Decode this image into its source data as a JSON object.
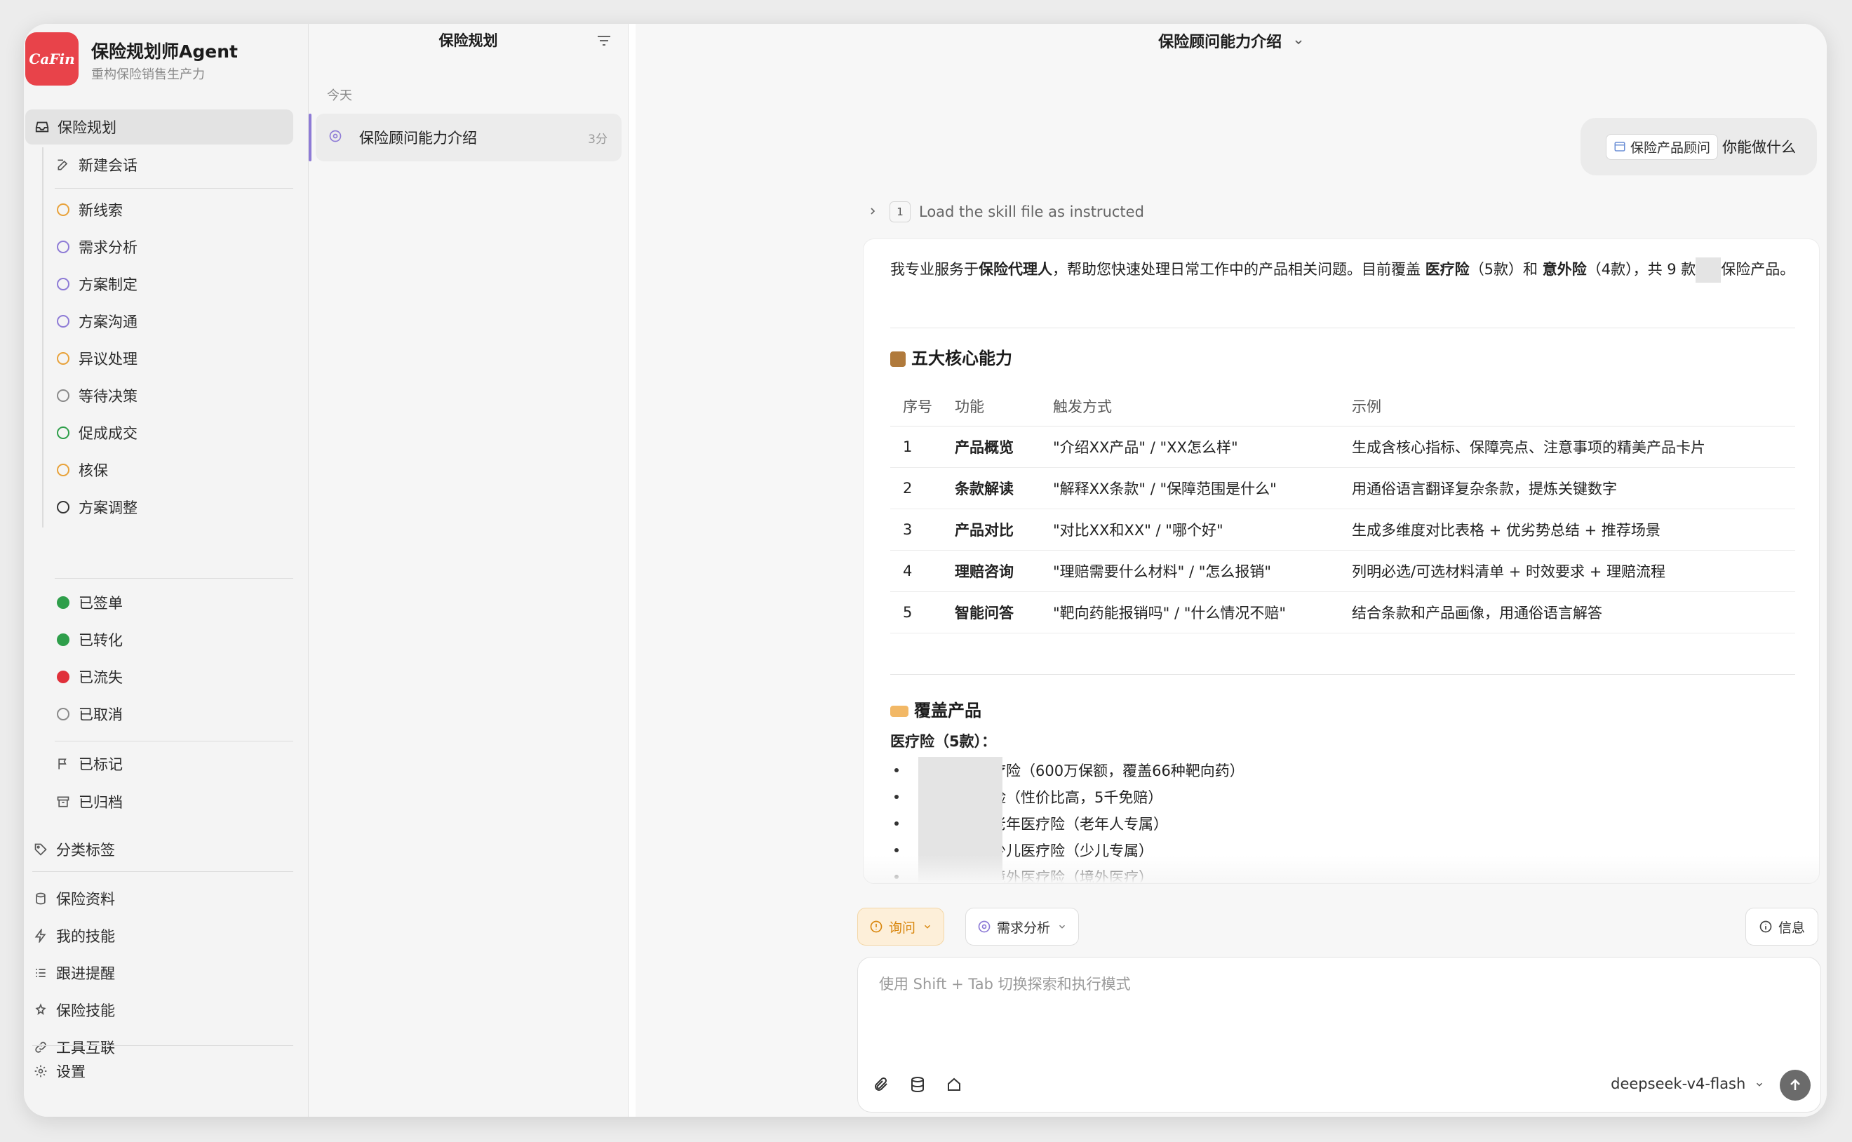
{
  "brand": {
    "logo_text": "CaFin",
    "title": "保险规划师Agent",
    "subtitle": "重构保险销售生产力"
  },
  "sidebar": {
    "main_item": "保险规划",
    "new_session": "新建会话",
    "stages": [
      {
        "label": "新线索",
        "color": "#e8a23a"
      },
      {
        "label": "需求分析",
        "color": "#8e7bd6"
      },
      {
        "label": "方案制定",
        "color": "#8e7bd6"
      },
      {
        "label": "方案沟通",
        "color": "#8e7bd6"
      },
      {
        "label": "异议处理",
        "color": "#e8a23a"
      },
      {
        "label": "等待决策",
        "color": "#8a8a8a"
      },
      {
        "label": "促成成交",
        "color": "#2e9e4a"
      },
      {
        "label": "核保",
        "color": "#e8a23a"
      },
      {
        "label": "方案调整",
        "color": "#333333"
      }
    ],
    "results": [
      {
        "label": "已签单",
        "color": "#2e9e4a"
      },
      {
        "label": "已转化",
        "color": "#2e9e4a"
      },
      {
        "label": "已流失",
        "color": "#e0303a"
      },
      {
        "label": "已取消",
        "color": "#8a8a8a"
      }
    ],
    "marked": "已标记",
    "archived": "已归档",
    "tags": "分类标签",
    "tools": [
      "保险资料",
      "我的技能",
      "跟进提醒",
      "保险技能",
      "工具互联"
    ],
    "settings": "设置"
  },
  "conversations": {
    "header": "保险规划",
    "group": "今天",
    "items": [
      {
        "title": "保险顾问能力介绍",
        "time": "3分"
      }
    ]
  },
  "chat": {
    "title": "保险顾问能力介绍",
    "user_chip": "保险产品顾问",
    "user_text": "你能做什么",
    "skill_step_num": "1",
    "skill_step_text": "Load the skill file as instructed",
    "intro": {
      "p1": "我专业服务于",
      "b1": "保险代理人",
      "p2": "，帮助您快速处理日常工作中的产品相关问题。目前覆盖 ",
      "b2": "医疗险",
      "p3": "（5款）和 ",
      "b3": "意外险",
      "p4": "（4款），共 9 款",
      "p5": "保险产品。"
    },
    "section1_title": "五大核心能力",
    "table": {
      "headers": [
        "序号",
        "功能",
        "触发方式",
        "示例"
      ],
      "rows": [
        [
          "1",
          "产品概览",
          "\"介绍XX产品\" / \"XX怎么样\"",
          "生成含核心指标、保障亮点、注意事项的精美产品卡片"
        ],
        [
          "2",
          "条款解读",
          "\"解释XX条款\" / \"保障范围是什么\"",
          "用通俗语言翻译复杂条款，提炼关键数字"
        ],
        [
          "3",
          "产品对比",
          "\"对比XX和XX\" / \"哪个好\"",
          "生成多维度对比表格 + 优劣势总结 + 推荐场景"
        ],
        [
          "4",
          "理赔咨询",
          "\"理赔需要什么材料\" / \"怎么报销\"",
          "列明必选/可选材料清单 + 时效要求 + 理赔流程"
        ],
        [
          "5",
          "智能问答",
          "\"靶向药能报销吗\" / \"什么情况不赔\"",
          "结合条款和产品画像，用通俗语言解答"
        ]
      ]
    },
    "section2_title": "覆盖产品",
    "medical_title": "医疗险（5款）：",
    "medical_items": [
      "疗险（600万保额，覆盖66种靶向药）",
      "险（性价比高，5千免赔）",
      "老年医疗险（老年人专属）",
      "少儿医疗险（少儿专属）",
      "境外医疗险（境外医疗）"
    ]
  },
  "composer": {
    "mode_ask": "询问",
    "mode_need": "需求分析",
    "info": "信息",
    "placeholder": "使用 Shift + Tab 切换探索和执行模式",
    "model": "deepseek-v4-flash"
  }
}
